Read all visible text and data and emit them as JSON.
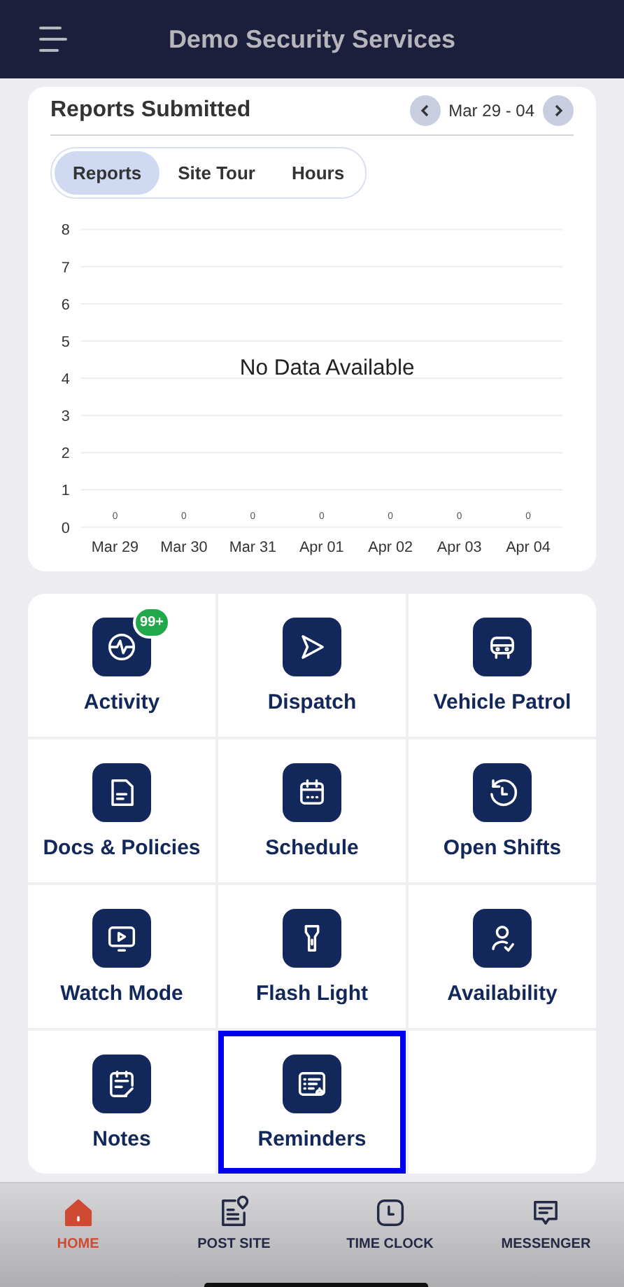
{
  "header": {
    "title": "Demo Security Services"
  },
  "reports_card": {
    "title": "Reports Submitted",
    "date_range": "Mar 29 - 04",
    "tabs": [
      {
        "label": "Reports",
        "selected": true
      },
      {
        "label": "Site Tour",
        "selected": false
      },
      {
        "label": "Hours",
        "selected": false
      }
    ],
    "chart_data": {
      "type": "bar",
      "categories": [
        "Mar 29",
        "Mar 30",
        "Mar 31",
        "Apr 01",
        "Apr 02",
        "Apr 03",
        "Apr 04"
      ],
      "values": [
        0,
        0,
        0,
        0,
        0,
        0,
        0
      ],
      "ylim": [
        0,
        8
      ],
      "grid": true,
      "yticks": [
        0,
        1,
        2,
        3,
        4,
        5,
        6,
        7,
        8
      ],
      "data_labels": true,
      "annotations": [
        "No Data Available"
      ]
    }
  },
  "menu": [
    {
      "kind": "activity",
      "label": "Activity",
      "badge": "99+",
      "selected": false
    },
    {
      "kind": "dispatch",
      "label": "Dispatch",
      "selected": false
    },
    {
      "kind": "vehicle",
      "label": "Vehicle Patrol",
      "selected": false
    },
    {
      "kind": "docs",
      "label": "Docs & Policies",
      "selected": false
    },
    {
      "kind": "schedule",
      "label": "Schedule",
      "selected": false
    },
    {
      "kind": "shifts",
      "label": "Open Shifts",
      "selected": false
    },
    {
      "kind": "watch",
      "label": "Watch Mode",
      "selected": false
    },
    {
      "kind": "flash",
      "label": "Flash Light",
      "selected": false
    },
    {
      "kind": "availability",
      "label": "Availability",
      "selected": false
    },
    {
      "kind": "notes",
      "label": "Notes",
      "selected": false
    },
    {
      "kind": "reminders",
      "label": "Reminders",
      "selected": true
    }
  ],
  "bottom_nav": [
    {
      "kind": "home",
      "label": "HOME",
      "selected": true
    },
    {
      "kind": "post",
      "label": "POST SITE",
      "selected": false
    },
    {
      "kind": "clock",
      "label": "TIME CLOCK",
      "selected": false
    },
    {
      "kind": "messenger",
      "label": "MESSENGER",
      "selected": false
    }
  ]
}
